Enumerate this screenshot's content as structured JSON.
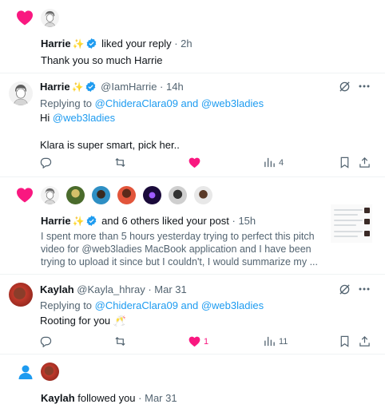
{
  "notif1": {
    "user": "Harrie",
    "sparkle": "✨",
    "action": "liked your reply",
    "time": "· 2h",
    "body": "Thank you so much Harrie"
  },
  "tweet1": {
    "name": "Harrie",
    "sparkle": "✨",
    "handle": "@IamHarrie",
    "time": "· 14h",
    "replying_prefix": "Replying to",
    "replying_users": "@ChideraClara09 and @web3ladies",
    "line1_prefix": "Hi",
    "line1_mention": "@web3ladies",
    "line2": "Klara is super smart, pick her..",
    "views": "4"
  },
  "notif2": {
    "user": "Harrie",
    "sparkle": "✨",
    "action": "and 6 others liked your post",
    "time": "· 15h",
    "body_line1": "I spent more than 5 hours yesterday trying to perfect this pitch",
    "body_line2": "video for @web3ladies MacBook application  and I have been",
    "body_line3": "trying to upload it since but I  couldn't, I would summarize my ..."
  },
  "tweet2": {
    "name": "Kaylah",
    "handle": "@Kayla_hhray",
    "time": "· Mar 31",
    "replying_prefix": "Replying to",
    "replying_users": "@ChideraClara09 and @web3ladies",
    "text": "Rooting for you",
    "emoji": "🥂",
    "likes": "1",
    "views": "11"
  },
  "notif3": {
    "user": "Kaylah",
    "action": "followed you",
    "time": "· Mar 31"
  },
  "colors": {
    "like": "#f91880",
    "accent": "#1d9bf0",
    "muted": "#536471"
  }
}
